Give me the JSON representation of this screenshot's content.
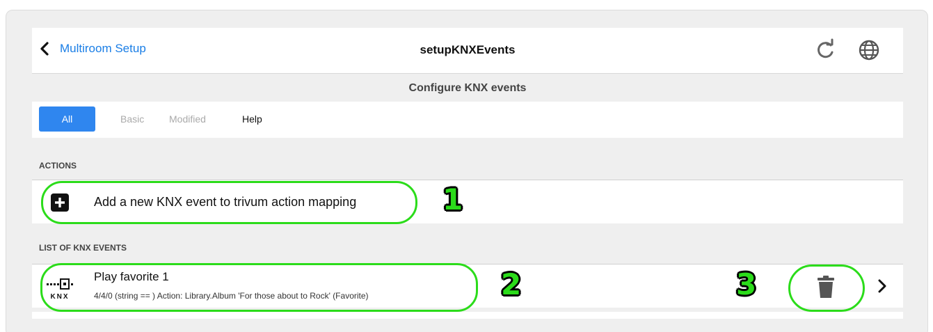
{
  "header": {
    "back_label": "Multiroom Setup",
    "title": "setupKNXEvents",
    "icons": [
      "chevron-left-icon",
      "refresh-icon",
      "globe-icon"
    ]
  },
  "subheader": {
    "title": "Configure KNX events"
  },
  "tabs": [
    {
      "label": "All",
      "active": true
    },
    {
      "label": "Basic",
      "active": false
    },
    {
      "label": "Modified",
      "active": false
    },
    {
      "label": "Help",
      "active": false
    }
  ],
  "actions": {
    "section_label": "ACTIONS",
    "add_label": "Add a new KNX event to trivum action mapping",
    "icon": "plus-icon"
  },
  "events": {
    "section_label": "LIST OF KNX EVENTS",
    "items": [
      {
        "title": "Play favorite 1",
        "subtitle": "4/4/0 (string == ) Action: Library.Album 'For those about to Rock' (Favorite)",
        "logo_text": "KNX",
        "icons": [
          "knx-logo-icon",
          "trash-icon",
          "chevron-right-icon"
        ]
      }
    ]
  },
  "annotations": {
    "n1": "1",
    "n2": "2",
    "n3": "3",
    "color": "#2bdc1a"
  },
  "colors": {
    "link": "#1a7ee6",
    "tab_active": "#2f86ef",
    "background": "#efefef"
  }
}
